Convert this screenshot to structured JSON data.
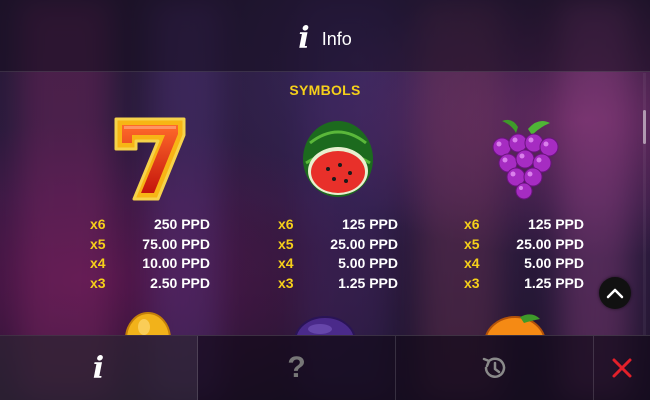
{
  "header": {
    "icon": "info-icon",
    "title": "Info"
  },
  "section": {
    "title": "SYMBOLS"
  },
  "symbols": [
    {
      "icon": "seven-icon",
      "payouts": [
        {
          "mult": "x6",
          "value": "250 PPD"
        },
        {
          "mult": "x5",
          "value": "75.00 PPD"
        },
        {
          "mult": "x4",
          "value": "10.00 PPD"
        },
        {
          "mult": "x3",
          "value": "2.50 PPD"
        }
      ]
    },
    {
      "icon": "watermelon-icon",
      "payouts": [
        {
          "mult": "x6",
          "value": "125 PPD"
        },
        {
          "mult": "x5",
          "value": "25.00 PPD"
        },
        {
          "mult": "x4",
          "value": "5.00 PPD"
        },
        {
          "mult": "x3",
          "value": "1.25 PPD"
        }
      ]
    },
    {
      "icon": "grapes-icon",
      "payouts": [
        {
          "mult": "x6",
          "value": "125 PPD"
        },
        {
          "mult": "x5",
          "value": "25.00 PPD"
        },
        {
          "mult": "x4",
          "value": "5.00 PPD"
        },
        {
          "mult": "x3",
          "value": "1.25 PPD"
        }
      ]
    }
  ],
  "partial_symbols": [
    "lemon-icon",
    "plum-icon",
    "orange-icon"
  ],
  "footer": {
    "tabs": [
      {
        "name": "tab-info",
        "icon": "info-icon",
        "label": "i",
        "active": true
      },
      {
        "name": "tab-help",
        "icon": "question-icon",
        "label": "?",
        "active": false
      },
      {
        "name": "tab-history",
        "icon": "history-icon",
        "active": false
      },
      {
        "name": "tab-close",
        "icon": "close-icon",
        "active": false
      }
    ]
  },
  "colors": {
    "accent_yellow": "#f6d01a",
    "close_red": "#e3202a"
  }
}
